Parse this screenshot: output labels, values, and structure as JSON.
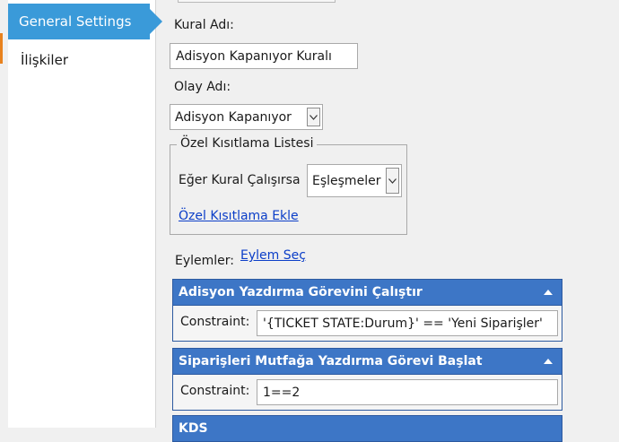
{
  "sidebar": {
    "active": "General Settings",
    "items": [
      "İlişkiler"
    ]
  },
  "form": {
    "rule_name_label": "Kural Adı:",
    "rule_name_value": "Adisyon Kapanıyor Kuralı",
    "event_label": "Olay Adı:",
    "event_value": "Adisyon Kapanıyor",
    "constraint_group_title": "Özel Kısıtlama Listesi",
    "if_rule_runs_label": "Eğer Kural Çalışırsa",
    "matches_value": "Eşleşmeler",
    "add_constraint_link": "Özel Kısıtlama Ekle",
    "actions_label": "Eylemler:",
    "choose_action_link": "Eylem Seç"
  },
  "actions": [
    {
      "title": "Adisyon Yazdırma Görevini Çalıştır",
      "constraint_label": "Constraint:",
      "constraint_value": "'{TICKET STATE:Durum}' == 'Yeni Siparişler'"
    },
    {
      "title": "Siparişleri Mutfağa Yazdırma Görevi Başlat",
      "constraint_label": "Constraint:",
      "constraint_value": "1==2"
    },
    {
      "title": "KDS"
    }
  ],
  "colors": {
    "sidebar_active": "#3a9ad9",
    "panel_header": "#3d76c6",
    "accent": "#e8821e",
    "link": "#0b3ec8"
  }
}
